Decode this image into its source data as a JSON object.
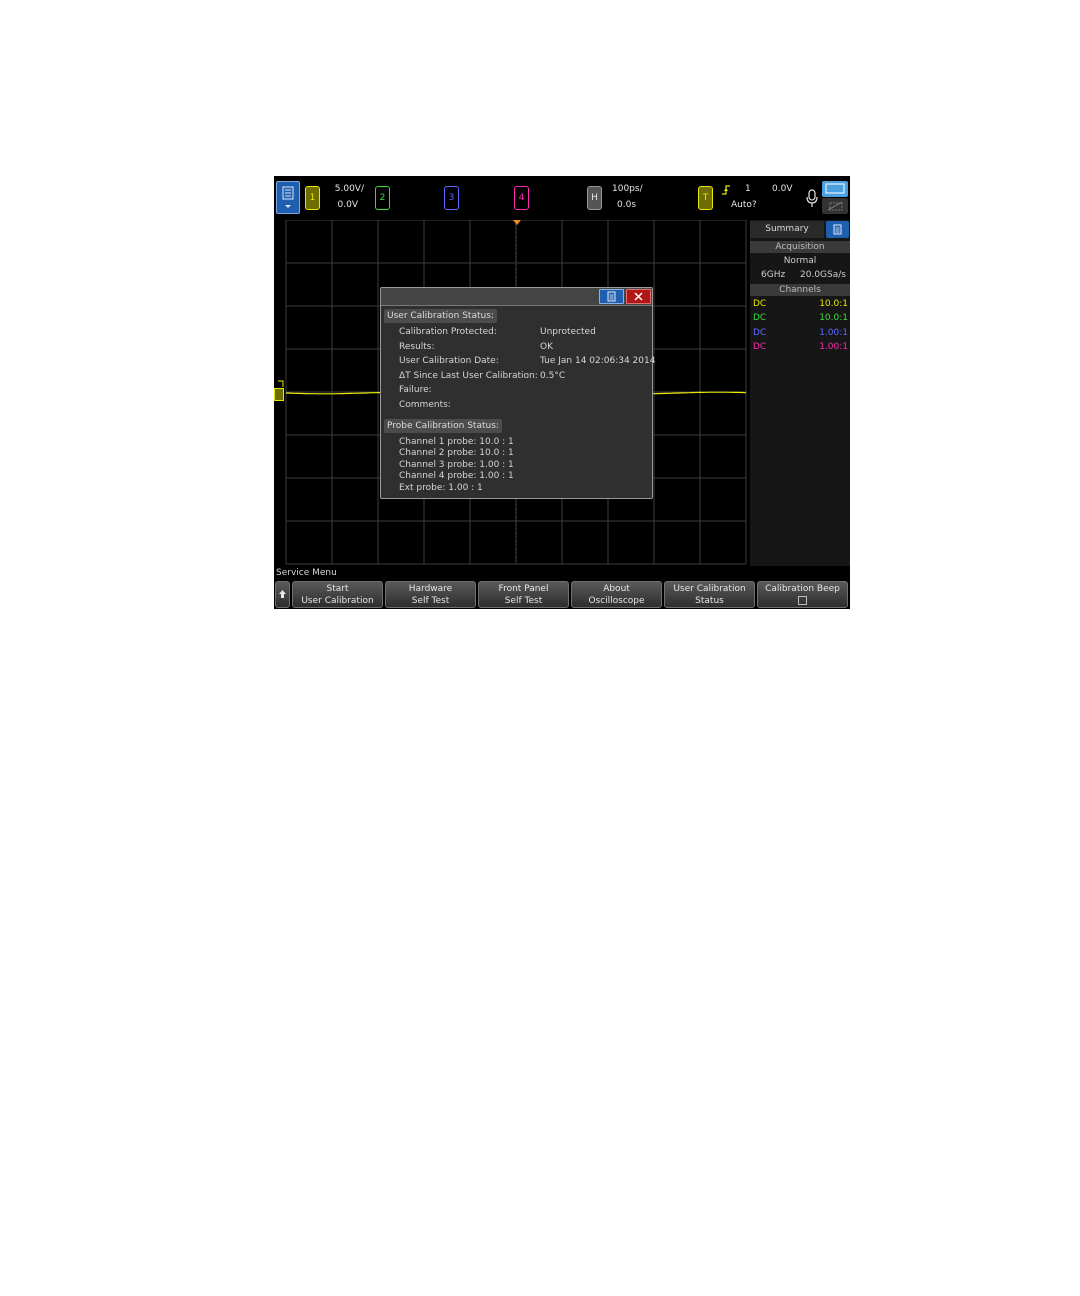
{
  "top_bar": {
    "channels": [
      {
        "label": "1",
        "color": "#e8e800",
        "scale": "5.00V/",
        "offset": "0.0V"
      },
      {
        "label": "2",
        "color": "#3ddc3d"
      },
      {
        "label": "3",
        "color": "#5f6bff"
      },
      {
        "label": "4",
        "color": "#ff2ab0"
      }
    ],
    "horizontal": {
      "label": "H",
      "timebase": "100ps/",
      "delay": "0.0s"
    },
    "trigger": {
      "label": "T",
      "source": "1",
      "level": "0.0V",
      "mode": "Auto?"
    }
  },
  "side_panel": {
    "summary_label": "Summary",
    "acquisition_header": "Acquisition",
    "acquisition_mode": "Normal",
    "bandwidth": "6GHz",
    "sample_rate": "20.0GSa/s",
    "channels_header": "Channels",
    "channels": [
      {
        "coupling": "DC",
        "ratio": "10.0:1",
        "color": "#e8e800"
      },
      {
        "coupling": "DC",
        "ratio": "10.0:1",
        "color": "#3ddc3d"
      },
      {
        "coupling": "DC",
        "ratio": "1.00:1",
        "color": "#5f6bff"
      },
      {
        "coupling": "DC",
        "ratio": "1.00:1",
        "color": "#ff2ab0"
      }
    ]
  },
  "dialog": {
    "user_cal_header": "User Calibration Status:",
    "rows": [
      {
        "label": "Calibration Protected:",
        "value": "Unprotected"
      },
      {
        "label": "Results:",
        "value": "OK"
      },
      {
        "label": "User Calibration Date:",
        "value": "Tue Jan 14 02:06:34 2014"
      },
      {
        "label": "ΔT Since Last User Calibration:",
        "value": "0.5°C"
      },
      {
        "label": "Failure:",
        "value": ""
      },
      {
        "label": "Comments:",
        "value": ""
      }
    ],
    "probe_cal_header": "Probe Calibration Status:",
    "probe_rows": [
      "Channel 1 probe: 10.0 : 1",
      "Channel 2 probe: 10.0 : 1",
      "Channel 3 probe: 1.00 : 1",
      "Channel 4 probe: 1.00 : 1",
      "Ext probe: 1.00 : 1"
    ]
  },
  "softkeys": {
    "menu_title": "Service Menu",
    "keys": [
      {
        "line1": "Start",
        "line2": "User Calibration"
      },
      {
        "line1": "Hardware",
        "line2": "Self Test"
      },
      {
        "line1": "Front Panel",
        "line2": "Self Test"
      },
      {
        "line1": "About",
        "line2": "Oscilloscope"
      },
      {
        "line1": "User Calibration",
        "line2": "Status"
      },
      {
        "line1": "Calibration Beep",
        "line2": ""
      }
    ]
  },
  "colors": {
    "accent_blue": "#1f5fb0",
    "close_red": "#b01818",
    "trace_yellow": "#e8e800"
  }
}
